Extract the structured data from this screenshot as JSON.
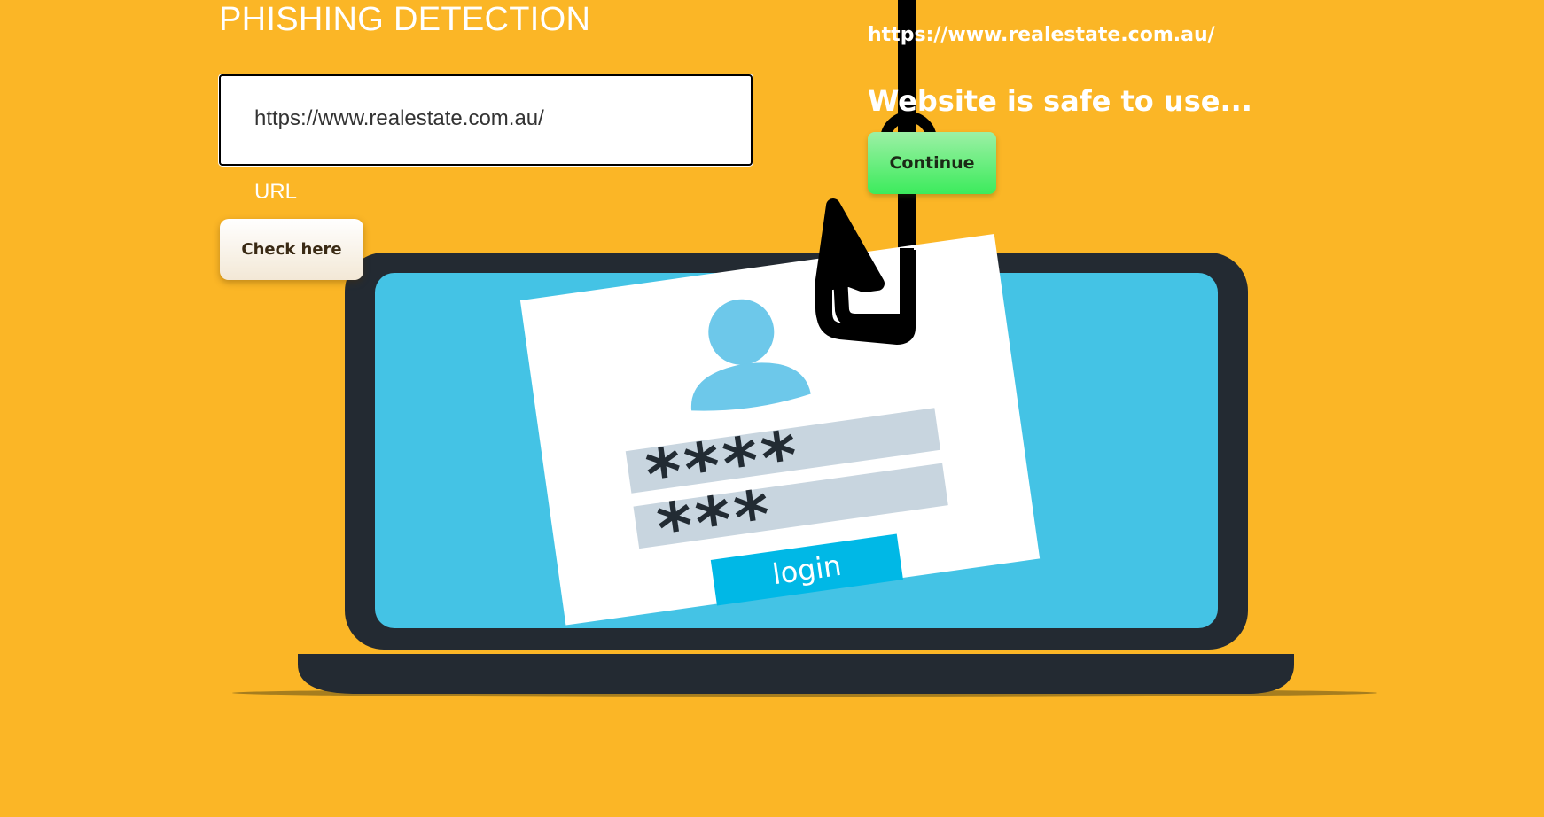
{
  "page": {
    "title": "PHISHING DETECTION",
    "background_color": "#fbb626"
  },
  "form": {
    "url_value": "https://www.realestate.com.au/",
    "url_label": "URL",
    "check_button_label": "Check here"
  },
  "result": {
    "checked_url": "https://www.realestate.com.au/",
    "message": "Website is safe to use...",
    "continue_button_label": "Continue",
    "continue_button_color": "#3ceb5c"
  },
  "illustration": {
    "subject": "laptop-phishing-hook-illustration",
    "password_field_1": "****",
    "password_field_2": "***",
    "login_label": "login",
    "colors": {
      "laptop_body": "#232a32",
      "screen": "#44c3e5",
      "login_button": "#00b8e6",
      "field": "#c8d5df",
      "user_icon": "#6dc8ea",
      "hook": "#000000"
    }
  }
}
